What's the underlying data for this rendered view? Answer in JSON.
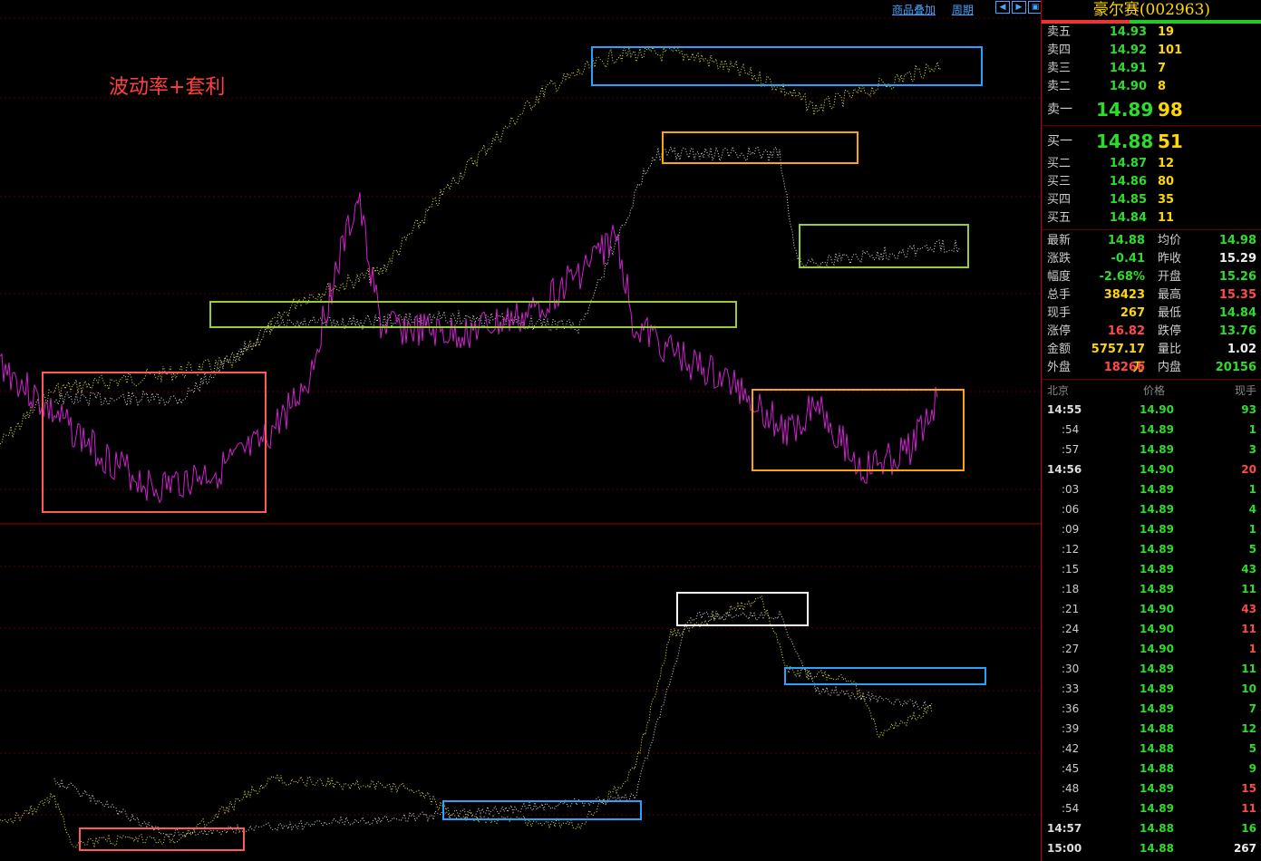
{
  "toolbar": {
    "overlay_label": "商品叠加",
    "period_label": "周期"
  },
  "chart_label": "波动率+套利",
  "stock": {
    "name": "豪尔赛",
    "code": "(002963)"
  },
  "sell_orders": [
    {
      "label": "卖五",
      "price": "14.93",
      "qty": "19"
    },
    {
      "label": "卖四",
      "price": "14.92",
      "qty": "101"
    },
    {
      "label": "卖三",
      "price": "14.91",
      "qty": "7"
    },
    {
      "label": "卖二",
      "price": "14.90",
      "qty": "8"
    },
    {
      "label": "卖一",
      "price": "14.89",
      "qty": "98"
    }
  ],
  "buy_orders": [
    {
      "label": "买一",
      "price": "14.88",
      "qty": "51"
    },
    {
      "label": "买二",
      "price": "14.87",
      "qty": "12"
    },
    {
      "label": "买三",
      "price": "14.86",
      "qty": "80"
    },
    {
      "label": "买四",
      "price": "14.85",
      "qty": "35"
    },
    {
      "label": "买五",
      "price": "14.84",
      "qty": "11"
    }
  ],
  "stats": [
    {
      "l1": "最新",
      "v1": "14.88",
      "c1": "green",
      "l2": "均价",
      "v2": "14.98",
      "c2": "green"
    },
    {
      "l1": "涨跌",
      "v1": "-0.41",
      "c1": "green",
      "l2": "昨收",
      "v2": "15.29",
      "c2": "white"
    },
    {
      "l1": "幅度",
      "v1": "-2.68%",
      "c1": "green",
      "l2": "开盘",
      "v2": "15.26",
      "c2": "green"
    },
    {
      "l1": "总手",
      "v1": "38423",
      "c1": "yellow",
      "l2": "最高",
      "v2": "15.35",
      "c2": "red"
    },
    {
      "l1": "现手",
      "v1": "267",
      "c1": "yellow",
      "l2": "最低",
      "v2": "14.84",
      "c2": "green"
    },
    {
      "l1": "涨停",
      "v1": "16.82",
      "c1": "red",
      "l2": "跌停",
      "v2": "13.76",
      "c2": "green"
    },
    {
      "l1": "金额",
      "v1": "5757.17万",
      "c1": "yellow",
      "l2": "量比",
      "v2": "1.02",
      "c2": "white"
    },
    {
      "l1": "外盘",
      "v1": "18266",
      "c1": "red",
      "l2": "内盘",
      "v2": "20156",
      "c2": "green"
    }
  ],
  "ticks_header": {
    "time": "北京",
    "price": "价格",
    "vol": "现手"
  },
  "ticks": [
    {
      "time": "14:55",
      "price": "14.90",
      "pc": "green",
      "vol": "93",
      "vc": "green",
      "major": true
    },
    {
      "time": ":54",
      "price": "14.89",
      "pc": "green",
      "vol": "1",
      "vc": "green",
      "major": false
    },
    {
      "time": ":57",
      "price": "14.89",
      "pc": "green",
      "vol": "3",
      "vc": "green",
      "major": false
    },
    {
      "time": "14:56",
      "price": "14.90",
      "pc": "green",
      "vol": "20",
      "vc": "red",
      "major": true
    },
    {
      "time": ":03",
      "price": "14.89",
      "pc": "green",
      "vol": "1",
      "vc": "green",
      "major": false
    },
    {
      "time": ":06",
      "price": "14.89",
      "pc": "green",
      "vol": "4",
      "vc": "green",
      "major": false
    },
    {
      "time": ":09",
      "price": "14.89",
      "pc": "green",
      "vol": "1",
      "vc": "green",
      "major": false
    },
    {
      "time": ":12",
      "price": "14.89",
      "pc": "green",
      "vol": "5",
      "vc": "green",
      "major": false
    },
    {
      "time": ":15",
      "price": "14.89",
      "pc": "green",
      "vol": "43",
      "vc": "green",
      "major": false
    },
    {
      "time": ":18",
      "price": "14.89",
      "pc": "green",
      "vol": "11",
      "vc": "green",
      "major": false
    },
    {
      "time": ":21",
      "price": "14.90",
      "pc": "green",
      "vol": "43",
      "vc": "red",
      "major": false
    },
    {
      "time": ":24",
      "price": "14.90",
      "pc": "green",
      "vol": "11",
      "vc": "red",
      "major": false
    },
    {
      "time": ":27",
      "price": "14.90",
      "pc": "green",
      "vol": "1",
      "vc": "red",
      "major": false
    },
    {
      "time": ":30",
      "price": "14.89",
      "pc": "green",
      "vol": "11",
      "vc": "green",
      "major": false
    },
    {
      "time": ":33",
      "price": "14.89",
      "pc": "green",
      "vol": "10",
      "vc": "green",
      "major": false
    },
    {
      "time": ":36",
      "price": "14.89",
      "pc": "green",
      "vol": "7",
      "vc": "green",
      "major": false
    },
    {
      "time": ":39",
      "price": "14.88",
      "pc": "green",
      "vol": "12",
      "vc": "green",
      "major": false
    },
    {
      "time": ":42",
      "price": "14.88",
      "pc": "green",
      "vol": "5",
      "vc": "green",
      "major": false
    },
    {
      "time": ":45",
      "price": "14.88",
      "pc": "green",
      "vol": "9",
      "vc": "green",
      "major": false
    },
    {
      "time": ":48",
      "price": "14.89",
      "pc": "green",
      "vol": "15",
      "vc": "red",
      "major": false
    },
    {
      "time": ":54",
      "price": "14.89",
      "pc": "green",
      "vol": "11",
      "vc": "red",
      "major": false
    },
    {
      "time": "14:57",
      "price": "14.88",
      "pc": "green",
      "vol": "16",
      "vc": "green",
      "major": true
    },
    {
      "time": "15:00",
      "price": "14.88",
      "pc": "green",
      "vol": "267",
      "vc": "white",
      "major": true
    }
  ]
}
